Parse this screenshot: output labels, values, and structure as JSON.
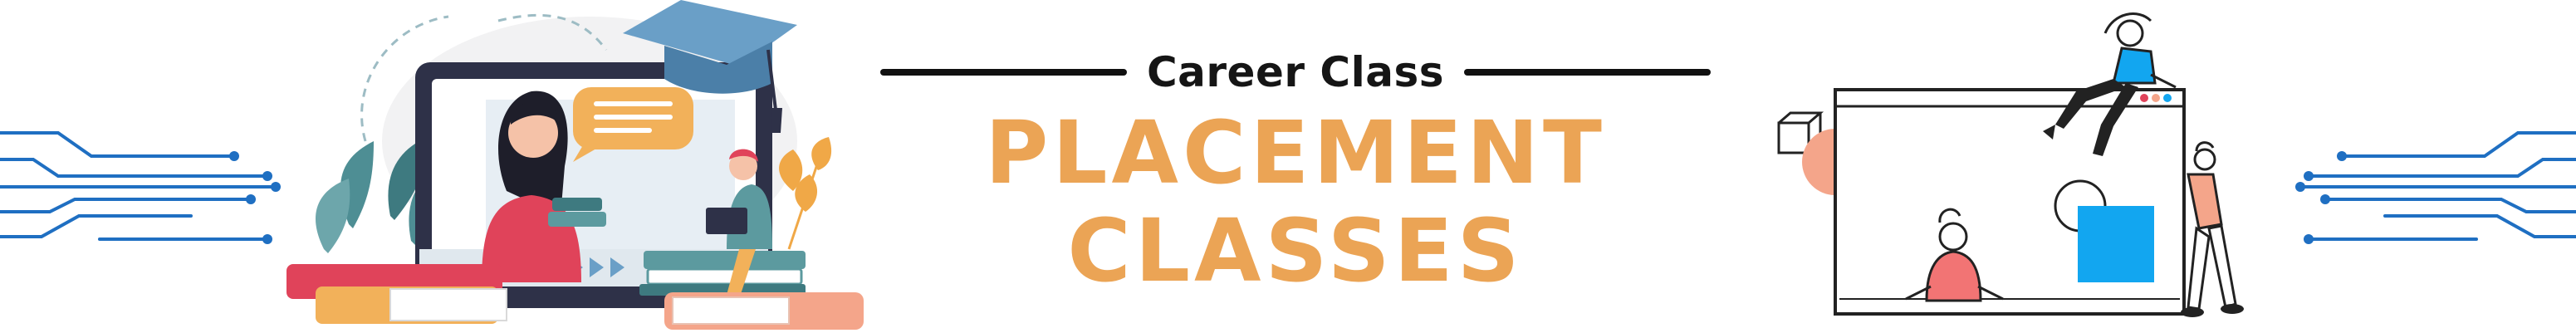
{
  "banner": {
    "eyebrow": "Career Class",
    "headline_line1": "PLACEMENT",
    "headline_line2": "CLASSES"
  },
  "colors": {
    "accent": "#EBA455",
    "text_dark": "#151515",
    "circuit_blue": "#1F6FC2",
    "cap_blue": "#6A9FC7",
    "bright_blue": "#12A6F0",
    "shirt_red": "#E0435A",
    "salmon": "#F4A58A",
    "teal": "#5C9A9F",
    "leaf_orange": "#F0A847"
  },
  "icons": [
    "circuit-lines-left-icon",
    "laptop-icon",
    "graduation-cap-icon",
    "chat-bubble-icon",
    "book-stack-icon",
    "plant-leaf-icon",
    "browser-window-icon",
    "circuit-lines-right-icon"
  ]
}
